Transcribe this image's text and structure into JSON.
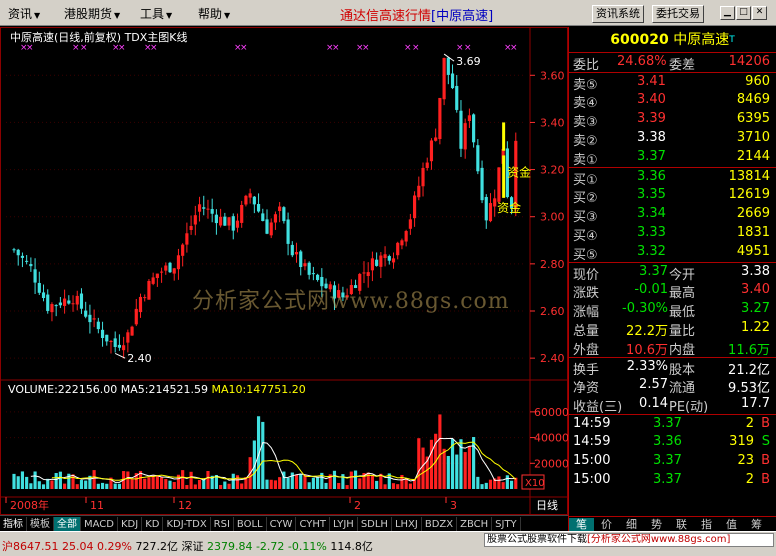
{
  "menu": {
    "items": [
      "资讯",
      "港股期货",
      "工具",
      "帮助"
    ],
    "app_title": "通达信高速行情",
    "title_bracket": "[中原高速]",
    "btn_info": "资讯系统",
    "btn_trade": "委托交易"
  },
  "chart": {
    "header": "中原高速(日线,前复权) TDX主图K线",
    "price_ticks": [
      "3.60",
      "3.40",
      "3.20",
      "3.00",
      "2.80",
      "2.60",
      "2.40"
    ],
    "high_label": "3.69",
    "low_label": "2.40",
    "capital_label_1": "资金",
    "capital_label_2": "资金",
    "vol_header": {
      "volume": "VOLUME:222156.00",
      "ma5": "MA5:214521.59",
      "ma10": "MA10:147751.20"
    },
    "vol_ticks": [
      "60000",
      "40000",
      "20000"
    ],
    "x10_label": "X10",
    "month_labels": [
      "2008年",
      "11",
      "12",
      "2",
      "3"
    ],
    "period_label": "日线",
    "watermark": "分析家公式网www.88gs.com",
    "colors": {
      "up": "#ff2020",
      "down": "#40e0e0",
      "ma5": "#ffffff",
      "ma10": "#ffff00",
      "grid": "#8b0000"
    }
  },
  "tabs": [
    "指标",
    "模板",
    "全部",
    "MACD",
    "KDJ",
    "KD",
    "KDJ-TDX",
    "RSI",
    "BOLL",
    "CYW",
    "CYHT",
    "LYJH",
    "SDLH",
    "LHXJ",
    "BDZX",
    "ZBCH",
    "SJTY"
  ],
  "quote": {
    "code": "600020",
    "name": "中原高速",
    "tag": "T",
    "weibi_label": "委比",
    "weibi": "24.68%",
    "weicha_label": "委差",
    "weicha": "14206",
    "sells": [
      {
        "label": "卖⑤",
        "price": "3.41",
        "vol": "960"
      },
      {
        "label": "卖④",
        "price": "3.40",
        "vol": "8469"
      },
      {
        "label": "卖③",
        "price": "3.39",
        "vol": "6395"
      },
      {
        "label": "卖②",
        "price": "3.38",
        "vol": "3710"
      },
      {
        "label": "卖①",
        "price": "3.37",
        "vol": "2144"
      }
    ],
    "buys": [
      {
        "label": "买①",
        "price": "3.36",
        "vol": "13814"
      },
      {
        "label": "买②",
        "price": "3.35",
        "vol": "12619"
      },
      {
        "label": "买③",
        "price": "3.34",
        "vol": "2669"
      },
      {
        "label": "买④",
        "price": "3.33",
        "vol": "1831"
      },
      {
        "label": "买⑤",
        "price": "3.32",
        "vol": "4951"
      }
    ],
    "stats1": [
      {
        "l1": "现价",
        "v1": "3.37",
        "l2": "今开",
        "v2": "3.38"
      },
      {
        "l1": "涨跌",
        "v1": "-0.01",
        "l2": "最高",
        "v2": "3.40"
      },
      {
        "l1": "涨幅",
        "v1": "-0.30%",
        "l2": "最低",
        "v2": "3.27"
      },
      {
        "l1": "总量",
        "v1": "22.2万",
        "l2": "量比",
        "v2": "1.22"
      },
      {
        "l1": "外盘",
        "v1": "10.6万",
        "l2": "内盘",
        "v2": "11.6万"
      }
    ],
    "stats2": [
      {
        "l1": "换手",
        "v1": "2.33%",
        "l2": "股本",
        "v2": "21.2亿"
      },
      {
        "l1": "净资",
        "v1": "2.57",
        "l2": "流通",
        "v2": "9.53亿"
      },
      {
        "l1": "收益(三)",
        "v1": "0.14",
        "l2": "PE(动)",
        "v2": "17.7"
      }
    ],
    "trades": [
      {
        "time": "14:59",
        "price": "3.37",
        "vol": "2",
        "side": "B"
      },
      {
        "time": "14:59",
        "price": "3.36",
        "vol": "319",
        "side": "S"
      },
      {
        "time": "15:00",
        "price": "3.37",
        "vol": "23",
        "side": "B"
      },
      {
        "time": "15:00",
        "price": "3.37",
        "vol": "2",
        "side": "B"
      }
    ],
    "side_tabs": [
      "笔",
      "价",
      "细",
      "势",
      "联",
      "指",
      "值",
      "筹"
    ]
  },
  "status": {
    "sh_index": "沪8647.51",
    "sh_chg": "25.04",
    "sh_pct": "0.29%",
    "sh_amt": "727.2亿",
    "sz_label": "深证",
    "sz_index": "2379.84",
    "sz_chg": "-2.72",
    "sz_pct": "-0.11%",
    "sz_amt": "114.8亿",
    "ad_text": "股票公式股票软件下载",
    "ad_url": "[分析家公式网www.88gs.com]"
  }
}
